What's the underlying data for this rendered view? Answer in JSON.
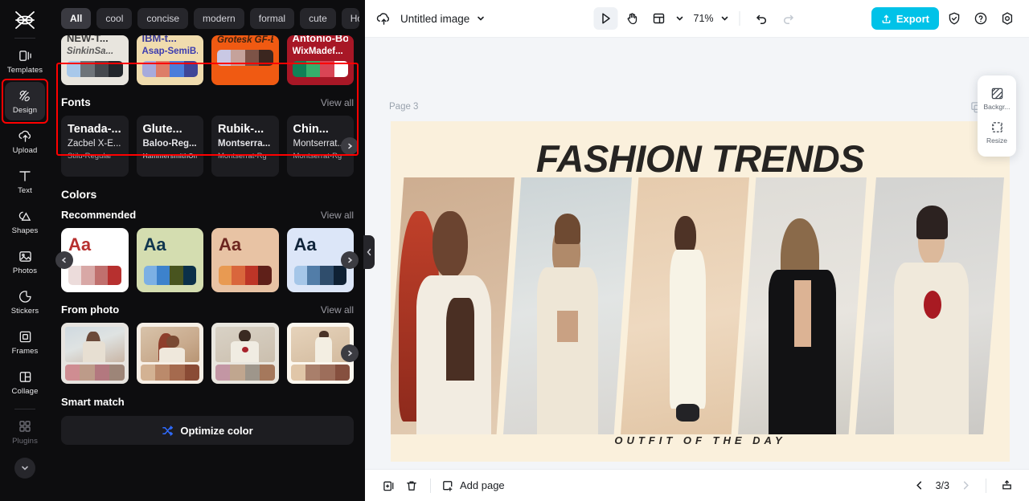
{
  "rail": {
    "logo_icon": "capcut-logo",
    "items": [
      {
        "label": "Templates",
        "icon": "templates-icon",
        "active": false
      },
      {
        "label": "Design",
        "icon": "design-icon",
        "active": true
      },
      {
        "label": "Upload",
        "icon": "upload-cloud-icon",
        "active": false
      },
      {
        "label": "Text",
        "icon": "text-icon",
        "active": false
      },
      {
        "label": "Shapes",
        "icon": "shapes-icon",
        "active": false
      },
      {
        "label": "Photos",
        "icon": "photos-icon",
        "active": false
      },
      {
        "label": "Stickers",
        "icon": "stickers-icon",
        "active": false
      },
      {
        "label": "Frames",
        "icon": "frames-icon",
        "active": false
      },
      {
        "label": "Collage",
        "icon": "collage-icon",
        "active": false
      }
    ],
    "plugins": {
      "label": "Plugins",
      "icon": "plugins-icon"
    },
    "expand_icon": "chevron-down-icon"
  },
  "panel": {
    "chips": [
      {
        "label": "All",
        "selected": true
      },
      {
        "label": "cool",
        "selected": false
      },
      {
        "label": "concise",
        "selected": false
      },
      {
        "label": "modern",
        "selected": false
      },
      {
        "label": "formal",
        "selected": false
      },
      {
        "label": "cute",
        "selected": false
      },
      {
        "label": "Holiday",
        "selected": false
      }
    ],
    "chips_more_icon": "chevron-down-icon",
    "font_strip": [
      {
        "line1": "NEW-T...",
        "line2": "SinkinSa...",
        "bg": "#e8e5de",
        "c1": "#3b3b3b",
        "c2": "#5a5a5a",
        "swatches": [
          "#a8c8ea",
          "#6e7479",
          "#45494e",
          "#22262b"
        ]
      },
      {
        "line1": "IBM-t...",
        "line2": "Asap-SemiB...",
        "bg": "#f0dcae",
        "c1": "#3c3c96",
        "c2": "#3b3bb0",
        "swatches": [
          "#a7abdc",
          "#dd7e68",
          "#4a7ddb",
          "#3f4697"
        ]
      },
      {
        "line1": "",
        "line2": "Grotesk GF-B...",
        "bg": "#f05a12",
        "c1": "#3a2212",
        "c2": "#3a2212",
        "swatches": [
          "#c9c8e4",
          "#c5a29b",
          "#7d5347",
          "#3b261f"
        ]
      },
      {
        "line1": "Antonio-Bold",
        "line2": "WixMadef...",
        "bg": "#a81726",
        "c1": "#ffffff",
        "c2": "#ffffff",
        "swatches": [
          "#0f8257",
          "#35b06c",
          "#d94555",
          "#ffffff"
        ]
      }
    ],
    "fonts_section": {
      "title": "Fonts",
      "view_all": "View all",
      "next_icon": "chevron-right-icon",
      "cards": [
        {
          "a": "Tenada-...",
          "b": "Zacbel X-E...",
          "c": "Stilu-Regular",
          "bold": false
        },
        {
          "a": "Glute...",
          "b": "Baloo-Reg...",
          "c": "HammersmithOn...",
          "bold": true
        },
        {
          "a": "Rubik-...",
          "b": "Montserra...",
          "c": "Montserrat-Rg",
          "bold": true
        },
        {
          "a": "Chin...",
          "b": "Montserrat...",
          "c": "Montserrat-Rg",
          "bold": false
        }
      ]
    },
    "colors_title": "Colors",
    "recommended": {
      "title": "Recommended",
      "view_all": "View all",
      "prev_icon": "chevron-left-icon",
      "next_icon": "chevron-right-icon",
      "highlighted": true,
      "palettes": [
        {
          "bg": "#ffffff",
          "aa": "Aa",
          "aa_color": "#b7302f",
          "swatches": [
            "#ecdcdb",
            "#d8a8a6",
            "#c0706e",
            "#b7302f"
          ]
        },
        {
          "bg": "#d4ddb0",
          "aa": "Aa",
          "aa_color": "#10364f",
          "swatches": [
            "#7cb0e4",
            "#3d82cc",
            "#48541f",
            "#0b3049"
          ]
        },
        {
          "bg": "#e8c3a4",
          "aa": "Aa",
          "aa_color": "#6d2620",
          "swatches": [
            "#e89a52",
            "#d9663c",
            "#bd3527",
            "#5f2019"
          ]
        },
        {
          "bg": "#dce6f8",
          "aa": "Aa",
          "aa_color": "#10243a",
          "swatches": [
            "#a5c6e8",
            "#527da8",
            "#2f4d6c",
            "#0f2134"
          ]
        }
      ]
    },
    "from_photo": {
      "title": "From photo",
      "view_all": "View all",
      "next_icon": "chevron-right-icon",
      "cards": [
        {
          "bg": "#e7e4e0",
          "swatches": [
            "#cf8d92",
            "#bd9b89",
            "#b3787f",
            "#9d8578"
          ]
        },
        {
          "bg": "#f6efe6",
          "swatches": [
            "#d3b293",
            "#bb8a6b",
            "#a56a4e",
            "#8a4b35"
          ]
        },
        {
          "bg": "#e9e6df",
          "swatches": [
            "#c396a4",
            "#c0a68f",
            "#9e968b",
            "#a5785c"
          ]
        },
        {
          "bg": "#fbf7ef",
          "swatches": [
            "#e0c6a8",
            "#a97f6b",
            "#9d6e5b",
            "#86503f"
          ]
        }
      ]
    },
    "smart_match": {
      "title": "Smart match",
      "button_label": "Optimize color",
      "button_icon": "shuffle-icon"
    },
    "collapse_icon": "chevron-left-icon"
  },
  "topbar": {
    "cloud_icon": "cloud-upload-icon",
    "doc_title": "Untitled image",
    "title_chevron_icon": "chevron-down-icon",
    "tools": [
      {
        "name": "select-tool",
        "icon": "cursor-icon",
        "active": true
      },
      {
        "name": "hand-tool",
        "icon": "hand-icon",
        "active": false
      },
      {
        "name": "layout-tool",
        "icon": "layout-icon",
        "active": false
      }
    ],
    "layout_chevron_icon": "chevron-down-icon",
    "zoom_value": "71%",
    "zoom_chevron_icon": "chevron-down-icon",
    "undo_icon": "undo-icon",
    "redo_icon": "redo-icon",
    "export_label": "Export",
    "export_icon": "export-upload-icon",
    "export_color": "#00c2e8",
    "shield_icon": "shield-icon",
    "help_icon": "help-circle-icon",
    "settings_icon": "settings-gear-icon"
  },
  "stage": {
    "page_label": "Page 3",
    "page_tools": [
      {
        "name": "duplicate-page-icon",
        "icon": "duplicate-icon"
      }
    ],
    "float_panel": [
      {
        "label": "Backgr...",
        "icon": "background-icon"
      },
      {
        "label": "Resize",
        "icon": "resize-icon"
      }
    ]
  },
  "canvas": {
    "bg": "#faf0dc",
    "title": "FASHION TRENDS",
    "subtitle": "OUTFIT OF THE DAY",
    "photos": [
      {
        "name": "model-red-braids",
        "bg": "#d7b79a"
      },
      {
        "name": "model-beige-shorts",
        "bg": "#cfd6d6"
      },
      {
        "name": "model-white-suit",
        "bg": "#e8cdb0"
      },
      {
        "name": "model-black-blazer",
        "bg": "#dcdcd8"
      },
      {
        "name": "model-cream-rose",
        "bg": "#d5d5d3"
      }
    ]
  },
  "bottombar": {
    "duplicate_icon": "duplicate-page-icon",
    "delete_icon": "trash-icon",
    "add_page_label": "Add page",
    "add_page_icon": "add-page-icon",
    "prev_icon": "chevron-left-icon",
    "next_icon": "chevron-right-icon",
    "page_indicator": "3/3",
    "present_icon": "present-icon"
  }
}
